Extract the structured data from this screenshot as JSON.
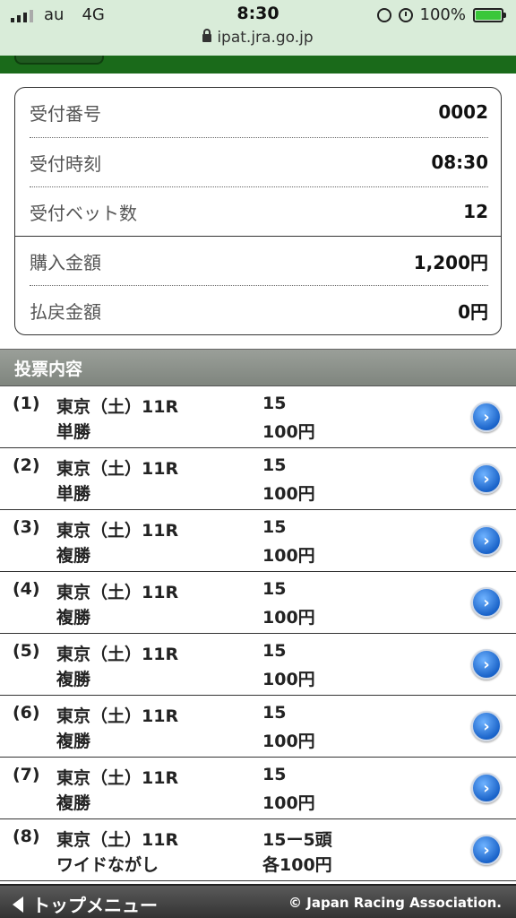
{
  "status_bar": {
    "carrier": "au",
    "network": "4G",
    "time": "8:30",
    "url": "ipat.jra.go.jp",
    "battery": "100%",
    "battery_color": "#3ac73a"
  },
  "summary": {
    "rows": [
      {
        "label": "受付番号",
        "value": "0002"
      },
      {
        "label": "受付時刻",
        "value": "08:30"
      },
      {
        "label": "受付ベット数",
        "value": "12"
      },
      {
        "label": "購入金額",
        "value": "1,200円"
      },
      {
        "label": "払戻金額",
        "value": "0円"
      }
    ]
  },
  "section_title": "投票内容",
  "bets": [
    {
      "num": "(1)",
      "race": "東京（土）11R",
      "type": "単勝",
      "horse": "15",
      "amount": "100円"
    },
    {
      "num": "(2)",
      "race": "東京（土）11R",
      "type": "単勝",
      "horse": "15",
      "amount": "100円"
    },
    {
      "num": "(3)",
      "race": "東京（土）11R",
      "type": "複勝",
      "horse": "15",
      "amount": "100円"
    },
    {
      "num": "(4)",
      "race": "東京（土）11R",
      "type": "複勝",
      "horse": "15",
      "amount": "100円"
    },
    {
      "num": "(5)",
      "race": "東京（土）11R",
      "type": "複勝",
      "horse": "15",
      "amount": "100円"
    },
    {
      "num": "(6)",
      "race": "東京（土）11R",
      "type": "複勝",
      "horse": "15",
      "amount": "100円"
    },
    {
      "num": "(7)",
      "race": "東京（土）11R",
      "type": "複勝",
      "horse": "15",
      "amount": "100円"
    },
    {
      "num": "(8)",
      "race": "東京（土）11R",
      "type": "ワイドながし",
      "horse": "15ー5頭",
      "amount": "各100円"
    }
  ],
  "footer": {
    "nav_label": "トップメニュー",
    "copyright": "© Japan Racing Association."
  },
  "icons": {
    "detail": "chevron-right-circle-icon",
    "back": "triangle-left-icon"
  }
}
